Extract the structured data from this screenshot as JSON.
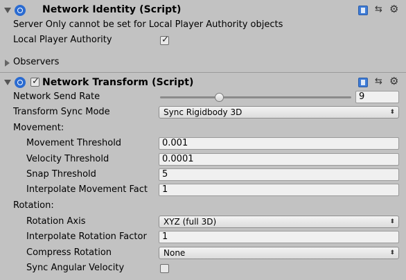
{
  "network_identity": {
    "title": "Network Identity (Script)",
    "icon": "network-identity-icon",
    "warning": "Server Only cannot be set for Local Player Authority objects",
    "local_player_authority_label": "Local Player Authority",
    "local_player_authority_checked": true,
    "observers_label": "Observers"
  },
  "network_transform": {
    "title": "Network Transform (Script)",
    "enabled": true,
    "send_rate_label": "Network Send Rate",
    "send_rate_value": "9",
    "send_rate_slider_fraction": 0.3,
    "sync_mode_label": "Transform Sync Mode",
    "sync_mode_value": "Sync Rigidbody 3D",
    "movement_label": "Movement:",
    "movement_threshold_label": "Movement Threshold",
    "movement_threshold_value": "0.001",
    "velocity_threshold_label": "Velocity Threshold",
    "velocity_threshold_value": "0.0001",
    "snap_threshold_label": "Snap Threshold",
    "snap_threshold_value": "5",
    "interp_movement_label": "Interpolate Movement Fact",
    "interp_movement_value": "1",
    "rotation_label": "Rotation:",
    "rotation_axis_label": "Rotation Axis",
    "rotation_axis_value": "XYZ (full 3D)",
    "interp_rotation_label": "Interpolate Rotation Factor",
    "interp_rotation_value": "1",
    "compress_rotation_label": "Compress Rotation",
    "compress_rotation_value": "None",
    "sync_angular_velocity_label": "Sync Angular Velocity",
    "sync_angular_velocity_checked": false
  },
  "colors": {
    "panel_bg": "#c2c2c2",
    "accent_blue": "#2a6bd1"
  }
}
